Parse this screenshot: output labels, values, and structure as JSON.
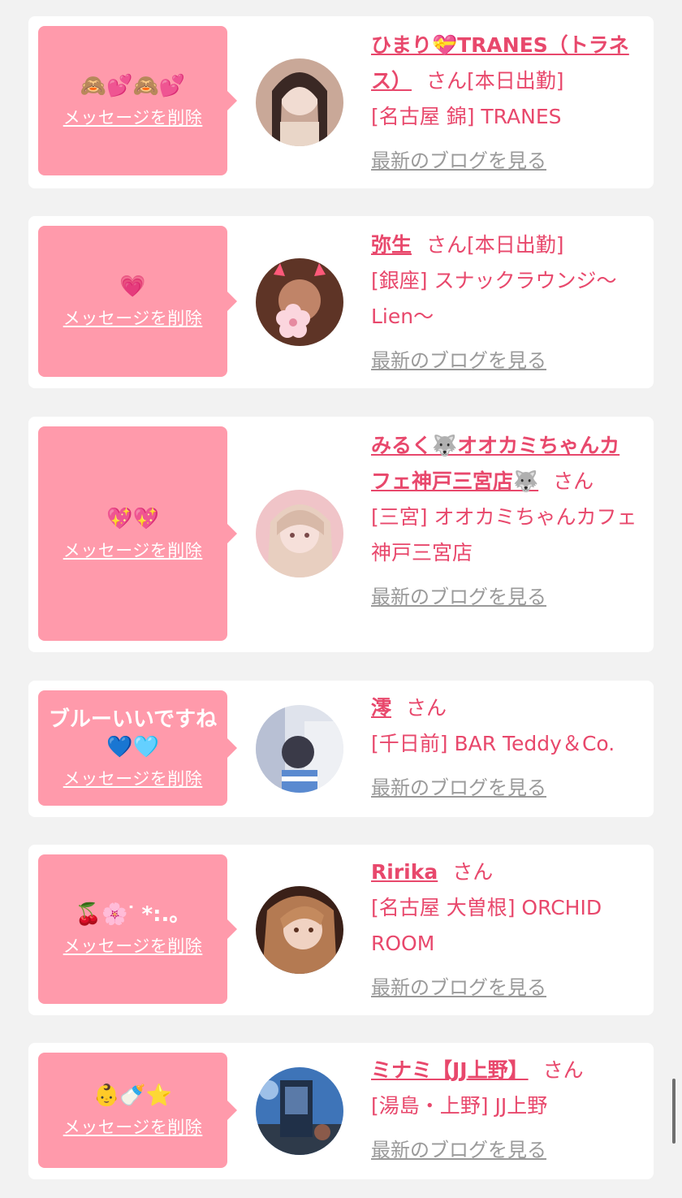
{
  "cards": [
    {
      "message": "🙈💕🙈💕",
      "delete_label": "メッセージを削除",
      "name": "ひまり💝TRANES（トラネス）",
      "san": "さん",
      "status": "[本日出勤]",
      "shop": "[名古屋 錦] TRANES",
      "blog_label": "最新のブログを見る",
      "avatar_colors": [
        "#d8b8a8",
        "#5a3a30"
      ]
    },
    {
      "message": "💗",
      "delete_label": "メッセージを削除",
      "name": "弥生",
      "san": "さん",
      "status": "[本日出勤]",
      "shop": "[銀座] スナックラウンジ〜Lien〜",
      "blog_label": "最新のブログを見る",
      "avatar_colors": [
        "#6a3a2a",
        "#f5c8d0"
      ]
    },
    {
      "message": "💖💖",
      "delete_label": "メッセージを削除",
      "name": "みるく🐺オオカミちゃんカフェ神戸三宮店🐺",
      "san": "さん",
      "status": "",
      "shop": "[三宮] オオカミちゃんカフェ神戸三宮店",
      "blog_label": "最新のブログを見る",
      "avatar_colors": [
        "#f0d0d0",
        "#c08a7a"
      ]
    },
    {
      "message": "ブルーいいですね\n💙🩵",
      "delete_label": "メッセージを削除",
      "name": "澪",
      "san": "さん",
      "status": "",
      "shop": "[千日前] BAR Teddy＆Co.",
      "blog_label": "最新のブログを見る",
      "avatar_colors": [
        "#c8d0e0",
        "#6a7aa0"
      ]
    },
    {
      "message": "🍒🌸ᐝ *:.。",
      "delete_label": "メッセージを削除",
      "name": "Ririka",
      "san": "さん",
      "status": "",
      "shop": "[名古屋 大曽根] ORCHID ROOM",
      "blog_label": "最新のブログを見る",
      "avatar_colors": [
        "#e0b090",
        "#3a2018"
      ]
    },
    {
      "message": "👶🍼⭐",
      "delete_label": "メッセージを削除",
      "name": "ミナミ【JJ上野】",
      "san": "さん",
      "status": "",
      "shop": "[湯島・上野] JJ上野",
      "blog_label": "最新のブログを見る",
      "avatar_colors": [
        "#3a6aa0",
        "#2a3040"
      ]
    }
  ]
}
